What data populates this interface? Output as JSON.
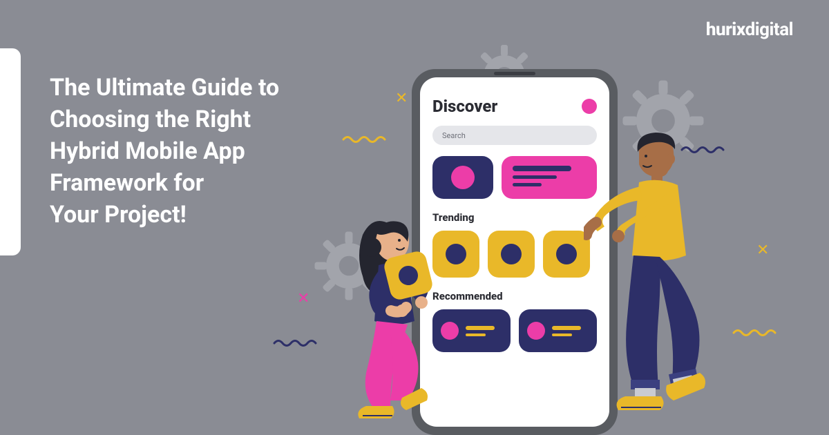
{
  "brand": {
    "part1": "hurix",
    "part2": "digital"
  },
  "headline": "The Ultimate Guide to\nChoosing the Right\nHybrid Mobile App\nFramework for\nYour Project!",
  "phone": {
    "title": "Discover",
    "search_placeholder": "Search",
    "section_trending": "Trending",
    "section_recommended": "Recommended"
  },
  "colors": {
    "background": "#8A8C94",
    "navy": "#2D2F68",
    "pink": "#EC3DA8",
    "yellow": "#E9B829"
  }
}
